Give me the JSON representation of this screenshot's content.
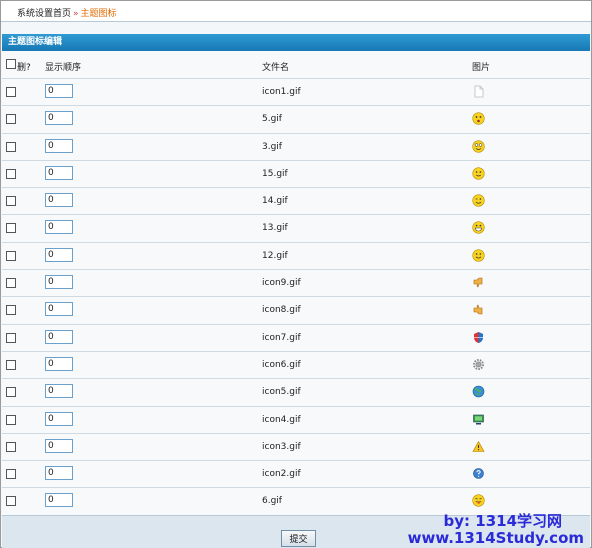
{
  "breadcrumb": {
    "home": "系统设置首页",
    "sep": "»",
    "current": "主题图标"
  },
  "section_title": "主题图标编辑",
  "columns": {
    "delete": "删?",
    "order": "显示顺序",
    "filename": "文件名",
    "picture": "图片"
  },
  "rows": [
    {
      "order": "0",
      "filename": "icon1.gif",
      "icon": "blank-page-icon"
    },
    {
      "order": "0",
      "filename": "5.gif",
      "icon": "surprised-face-icon"
    },
    {
      "order": "0",
      "filename": "3.gif",
      "icon": "grin-face-icon"
    },
    {
      "order": "0",
      "filename": "15.gif",
      "icon": "smile-face-icon"
    },
    {
      "order": "0",
      "filename": "14.gif",
      "icon": "wink-face-icon"
    },
    {
      "order": "0",
      "filename": "13.gif",
      "icon": "big-grin-face-icon"
    },
    {
      "order": "0",
      "filename": "12.gif",
      "icon": "happy-face-icon"
    },
    {
      "order": "0",
      "filename": "icon9.gif",
      "icon": "thumbs-down-icon"
    },
    {
      "order": "0",
      "filename": "icon8.gif",
      "icon": "thumbs-up-icon"
    },
    {
      "order": "0",
      "filename": "icon7.gif",
      "icon": "shield-icon"
    },
    {
      "order": "0",
      "filename": "icon6.gif",
      "icon": "gear-icon"
    },
    {
      "order": "0",
      "filename": "icon5.gif",
      "icon": "globe-icon"
    },
    {
      "order": "0",
      "filename": "icon4.gif",
      "icon": "monitor-icon"
    },
    {
      "order": "0",
      "filename": "icon3.gif",
      "icon": "warning-icon"
    },
    {
      "order": "0",
      "filename": "icon2.gif",
      "icon": "question-icon"
    },
    {
      "order": "0",
      "filename": "6.gif",
      "icon": "tongue-face-icon"
    }
  ],
  "submit_label": "提交",
  "watermark": {
    "line1": "by: 1314学习网",
    "line2": "www.1314Study.com"
  },
  "colors": {
    "header": "#1f88c4",
    "accent": "#e06a00",
    "border": "#cfd9e1"
  }
}
